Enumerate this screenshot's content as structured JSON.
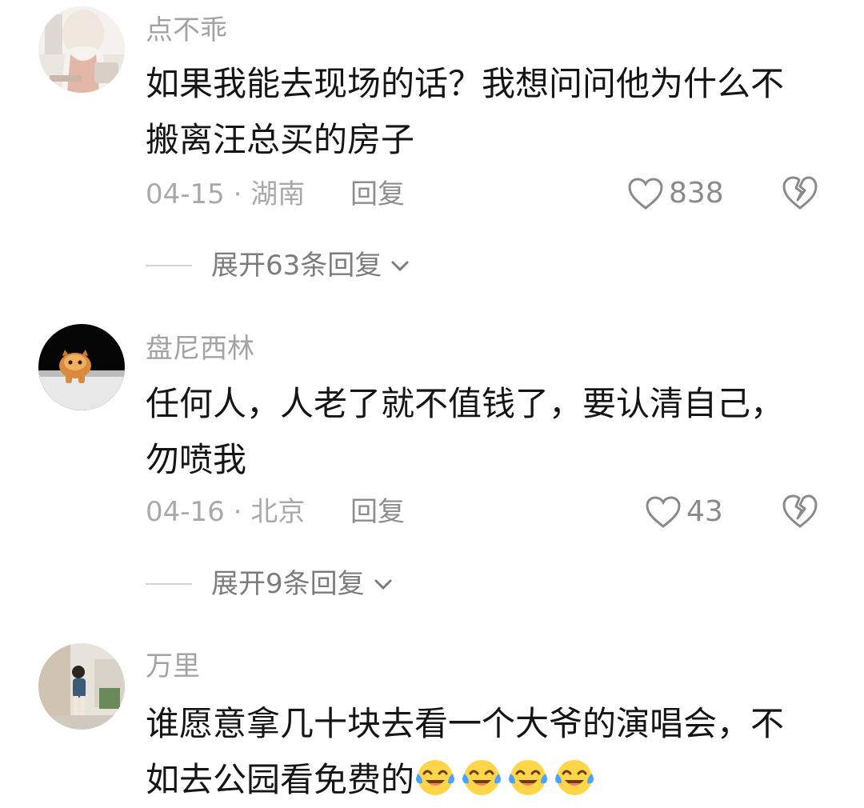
{
  "comments": [
    {
      "username": "点不乖",
      "avatar": "avatar-woman-kitchen",
      "text": "如果我能去现场的话？我想问问他为什么不搬离汪总买的房子",
      "meta": "04-15 · 湖南",
      "reply_label": "回复",
      "likes": "838",
      "expand_label": "展开63条回复"
    },
    {
      "username": "盘尼西林",
      "avatar": "avatar-orange-cat",
      "text": "任何人，人老了就不值钱了，要认清自己，勿喷我",
      "meta": "04-16 · 北京",
      "reply_label": "回复",
      "likes": "43",
      "expand_label": "展开9条回复"
    },
    {
      "username": "万里",
      "avatar": "avatar-girl-indoor",
      "text": "谁愿意拿几十块去看一个大爷的演唱会，不如去公园看免费的",
      "emoji_count": 4,
      "emoji": "crying-laughing-emoji"
    }
  ],
  "colors": {
    "username": "#a3a3a3",
    "text": "#151515",
    "meta": "#a9a9a9",
    "icon": "#8a8a8a",
    "emoji_face": "#ffd54a",
    "emoji_tears": "#4aa3ff"
  }
}
